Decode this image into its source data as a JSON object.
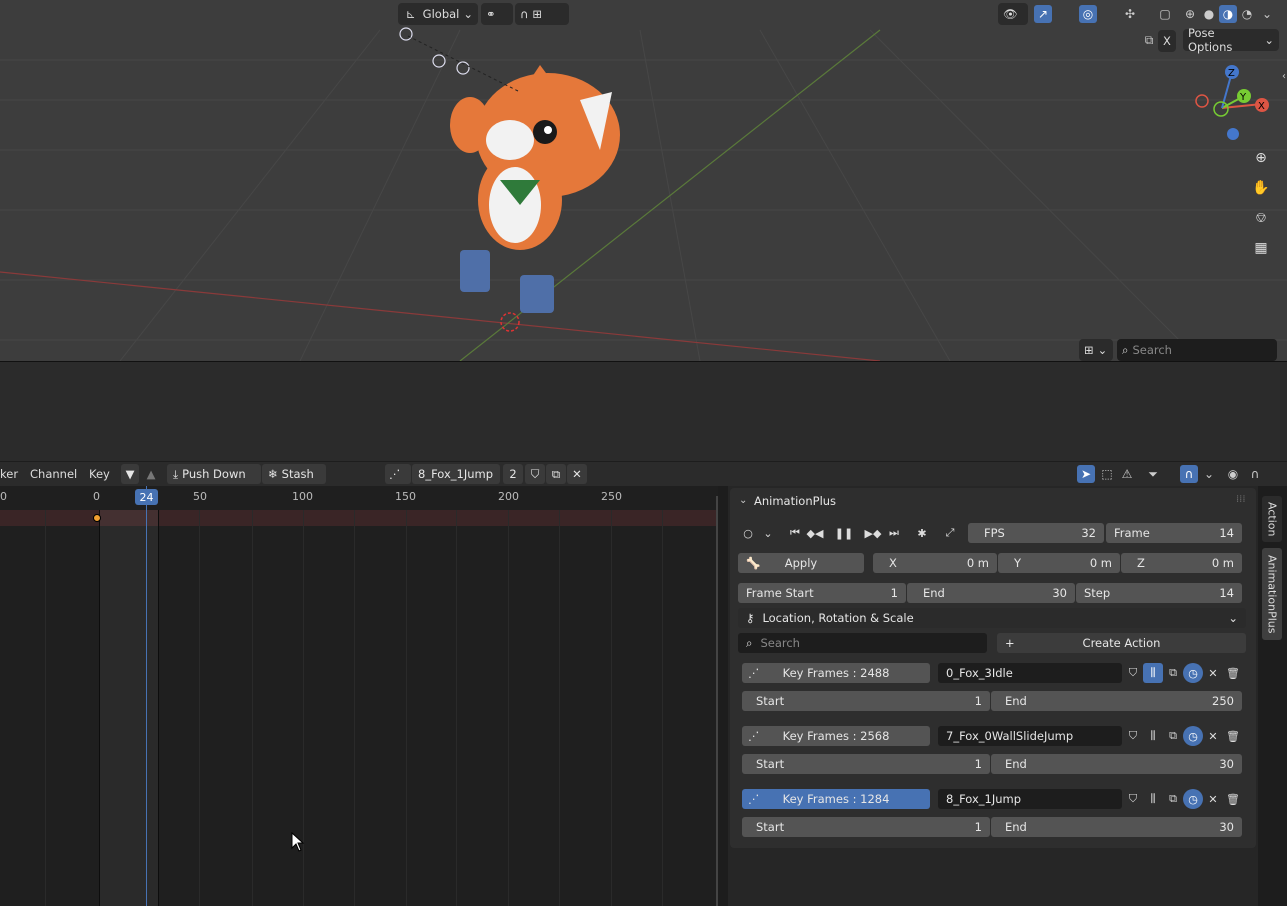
{
  "viewport": {
    "transform_orientation": "Global",
    "pose_options": "Pose Options",
    "x_mirror": "X",
    "search_placeholder": "Search",
    "gizmo": {
      "x": "X",
      "y": "Y",
      "z": "Z"
    }
  },
  "dopesheet": {
    "menus": [
      "ker",
      "Channel",
      "Key"
    ],
    "push_down": "Push Down",
    "stash": "Stash",
    "action_name": "8_Fox_1Jump",
    "user_count": "2",
    "ticks": [
      "0",
      "0",
      "50",
      "100",
      "150",
      "200",
      "250"
    ],
    "current_frame": "24"
  },
  "panel": {
    "title": "AnimationPlus",
    "fps_label": "FPS",
    "fps_value": "32",
    "frame_label": "Frame",
    "frame_value": "14",
    "apply_label": "Apply",
    "x_label": "X",
    "x_value": "0 m",
    "y_label": "Y",
    "y_value": "0 m",
    "z_label": "Z",
    "z_value": "0 m",
    "frame_start_label": "Frame Start",
    "frame_start_value": "1",
    "end_label": "End",
    "end_value": "30",
    "step_label": "Step",
    "step_value": "14",
    "keying_set": "Location, Rotation & Scale",
    "search_placeholder": "Search",
    "create_action": "Create Action",
    "actions": [
      {
        "keyframes": "Key Frames : 2488",
        "name": "0_Fox_3Idle",
        "start_label": "Start",
        "start": "1",
        "end_label": "End",
        "end": "250",
        "active": false
      },
      {
        "keyframes": "Key Frames : 2568",
        "name": "7_Fox_0WallSlideJump",
        "start_label": "Start",
        "start": "1",
        "end_label": "End",
        "end": "30",
        "active": false
      },
      {
        "keyframes": "Key Frames : 1284",
        "name": "8_Fox_1Jump",
        "start_label": "Start",
        "start": "1",
        "end_label": "End",
        "end": "30",
        "active": true
      }
    ]
  },
  "tabs": [
    "Action",
    "AnimationPlus"
  ],
  "colors": {
    "accent": "#4772b3",
    "viewport_bg": "#3d3d3d",
    "panel_bg": "#2e2e2e"
  }
}
